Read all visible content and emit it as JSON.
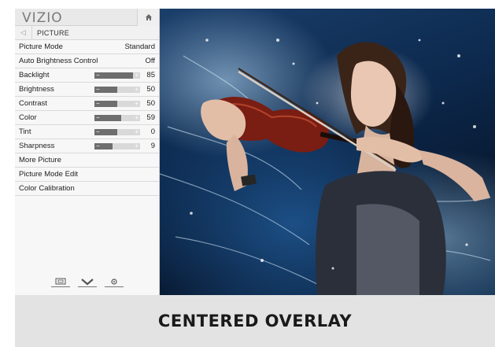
{
  "panel": {
    "logo": "VIZIO",
    "breadcrumb": "PICTURE",
    "rows": [
      {
        "label": "Picture Mode",
        "value": "Standard"
      },
      {
        "label": "Auto Brightness Control",
        "value": "Off"
      }
    ],
    "sliders": [
      {
        "label": "Backlight",
        "value": "85",
        "level": 0.85
      },
      {
        "label": "Brightness",
        "value": "50",
        "level": 0.5
      },
      {
        "label": "Contrast",
        "value": "50",
        "level": 0.5
      },
      {
        "label": "Color",
        "value": "59",
        "level": 0.59
      },
      {
        "label": "Tint",
        "value": "0",
        "level": 0.5
      },
      {
        "label": "Sharpness",
        "value": "9",
        "level": 0.4
      }
    ],
    "links": [
      {
        "label": "More Picture"
      },
      {
        "label": "Picture Mode Edit"
      },
      {
        "label": "Color Calibration"
      }
    ],
    "bottom_icons": [
      "input-icon",
      "chevron-down-icon",
      "settings-gear-icon"
    ]
  },
  "caption": "CENTERED OVERLAY",
  "colors": {
    "panel_bg": "#f7f7f7",
    "slider_fill": "#6e6e6e",
    "slider_track": "#d9d9d9",
    "caption_bg": "#e3e3e3"
  }
}
